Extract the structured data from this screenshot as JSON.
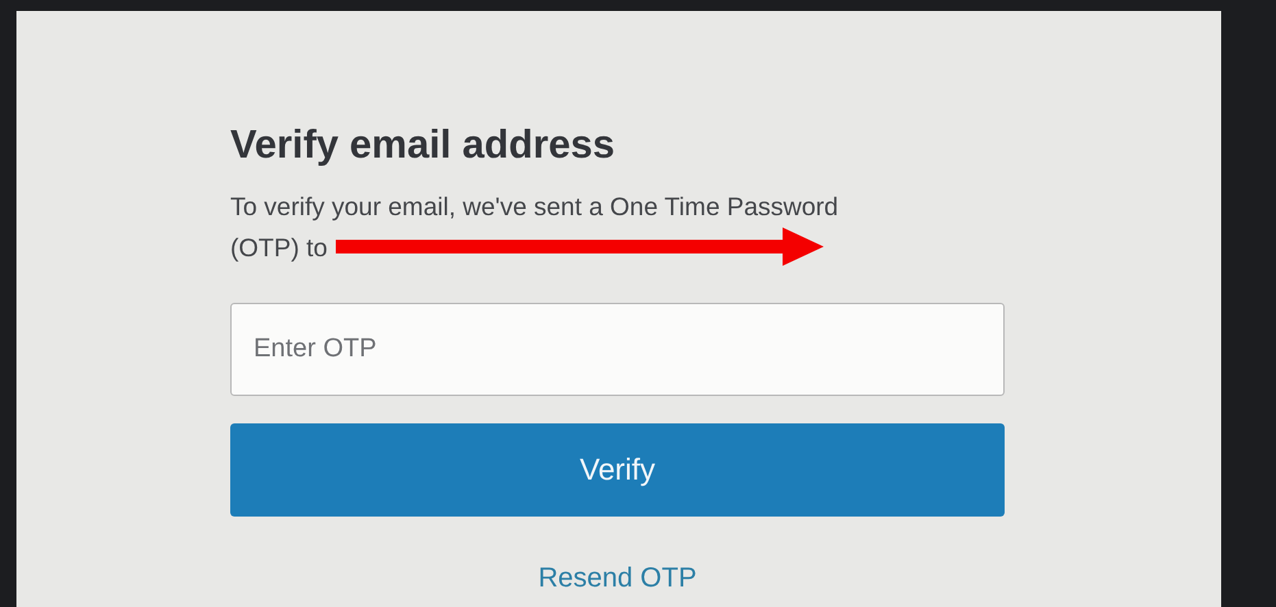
{
  "form": {
    "title": "Verify email address",
    "message_lines": [
      "To verify your email, we've sent a One Time Password",
      "(OTP) to"
    ],
    "otp_field": {
      "placeholder": "Enter OTP"
    },
    "verify_button": "Verify",
    "resend_link": "Resend OTP"
  }
}
